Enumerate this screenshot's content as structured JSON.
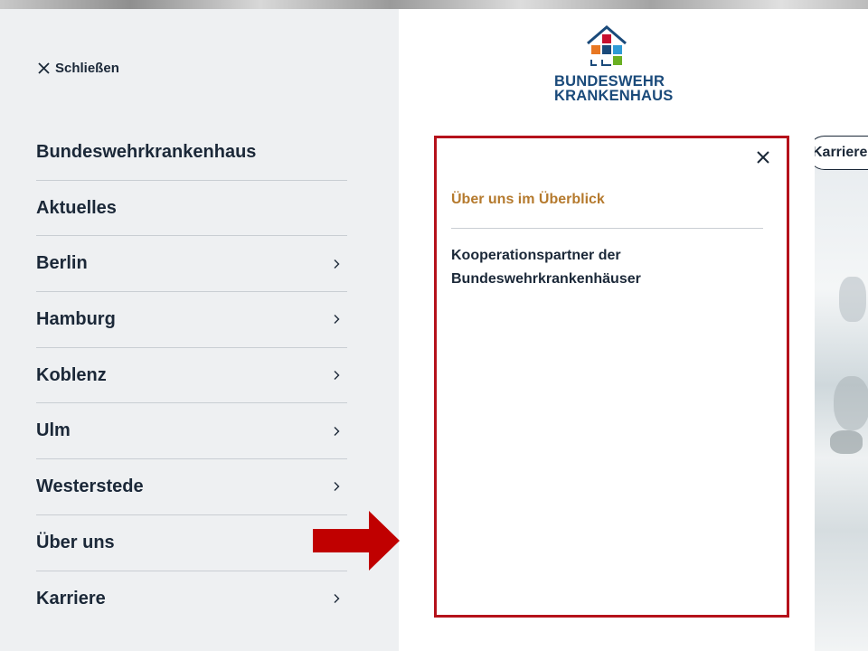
{
  "menu": {
    "close_label": "Schließen",
    "items": [
      {
        "label": "Bundeswehrkrankenhaus",
        "has_submenu": false
      },
      {
        "label": "Aktuelles",
        "has_submenu": false
      },
      {
        "label": "Berlin",
        "has_submenu": true
      },
      {
        "label": "Hamburg",
        "has_submenu": true
      },
      {
        "label": "Koblenz",
        "has_submenu": true
      },
      {
        "label": "Ulm",
        "has_submenu": true
      },
      {
        "label": "Westerstede",
        "has_submenu": true
      },
      {
        "label": "Über uns",
        "has_submenu": true
      },
      {
        "label": "Karriere",
        "has_submenu": true
      }
    ]
  },
  "logo": {
    "line1": "BUNDESWEHR",
    "line2": "KRANKENHAUS",
    "tile_colors": [
      "#c8102e",
      "#e87722",
      "#1a4a7a",
      "#2e9bd6",
      "#6ab023"
    ]
  },
  "header": {
    "karriere_button": "Karriere"
  },
  "submenu": {
    "heading": "Über uns im Überblick",
    "links": [
      "Kooperationspartner der Bundeswehrkrankenhäuser"
    ]
  },
  "colors": {
    "menu_bg": "#eef0f2",
    "text": "#1b2838",
    "accent": "#b57a2e",
    "annotation": "#b5121b"
  }
}
